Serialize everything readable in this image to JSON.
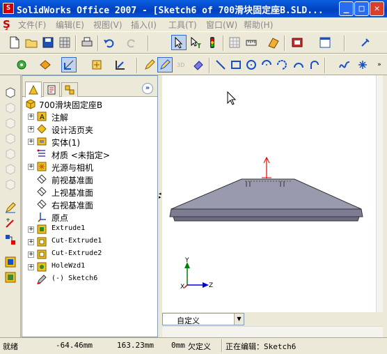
{
  "window": {
    "title": "SolidWorks Office 2007 - [Sketch6 of 700滑块固定座B.SLD...",
    "minimize": "_",
    "maximize": "□",
    "close": "✕"
  },
  "menu": [
    "文件(F)",
    "编辑(E)",
    "视图(V)",
    "插入(I)",
    "工具(T)",
    "窗口(W)",
    "帮助(H)"
  ],
  "toolbar_top": [
    "new-doc",
    "open",
    "save",
    "print",
    "undo",
    "redo",
    "select",
    "select-filter",
    "traffic-light",
    "grid",
    "options",
    "rebuild",
    "library",
    "palette",
    "render",
    "sw-window",
    "layout"
  ],
  "toolbar_sketch": [
    "smart-dim",
    "add-relation",
    "sketch-fillet",
    "sketch-tool",
    "convert-entities",
    "edit-sketch",
    "exit-sketch",
    "3d-sketch",
    "line",
    "rectangle",
    "circle",
    "center-arc",
    "tangent-arc",
    "centerpoint-arc",
    "3pt-arc",
    "spline",
    "point"
  ],
  "feature_manager": {
    "tabs": [
      "feature-tree",
      "property-manager",
      "configuration-manager"
    ],
    "collapse": "»",
    "root": "700滑块固定座B",
    "items": [
      {
        "label": "注解",
        "icon": "annotation-icon",
        "expandable": true,
        "mono": false
      },
      {
        "label": "设计活页夹",
        "icon": "design-binder-icon",
        "expandable": true,
        "mono": false
      },
      {
        "label": "实体(1)",
        "icon": "solid-body-icon",
        "expandable": true,
        "mono": false
      },
      {
        "label": "材质 <未指定>",
        "icon": "material-icon",
        "expandable": false,
        "mono": false
      },
      {
        "label": "光源与相机",
        "icon": "lights-icon",
        "expandable": true,
        "mono": false
      },
      {
        "label": "前视基准面",
        "icon": "plane-icon",
        "expandable": false,
        "mono": false
      },
      {
        "label": "上视基准面",
        "icon": "plane-icon",
        "expandable": false,
        "mono": false
      },
      {
        "label": "右视基准面",
        "icon": "plane-icon",
        "expandable": false,
        "mono": false
      },
      {
        "label": "原点",
        "icon": "origin-icon",
        "expandable": false,
        "mono": false
      },
      {
        "label": "Extrude1",
        "icon": "extrude-icon",
        "expandable": true,
        "mono": true
      },
      {
        "label": "Cut-Extrude1",
        "icon": "cut-extrude-icon",
        "expandable": true,
        "mono": true
      },
      {
        "label": "Cut-Extrude2",
        "icon": "cut-extrude-icon",
        "expandable": true,
        "mono": true
      },
      {
        "label": "HoleWzd1",
        "icon": "hole-wizard-icon",
        "expandable": true,
        "mono": true
      },
      {
        "label": "(-) Sketch6",
        "icon": "sketch-icon",
        "expandable": false,
        "mono": true
      }
    ]
  },
  "view": {
    "orientation_value": "自定义",
    "triad_x": "X",
    "triad_y": "Y",
    "triad_z": "Z"
  },
  "status": {
    "ready": "就绪",
    "x": "-64.46mm",
    "y": "163.23mm",
    "z": "0mm",
    "state": "欠定义",
    "editing": "正在编辑：Sketch6"
  },
  "colors": {
    "title_bar": "#0a54d8",
    "model_face": "#8c8ca0",
    "model_top": "#9898ac",
    "sketch_arrow": "#e00000",
    "triad_x": "#e00000",
    "triad_y": "#008000",
    "triad_z": "#0000e0"
  }
}
